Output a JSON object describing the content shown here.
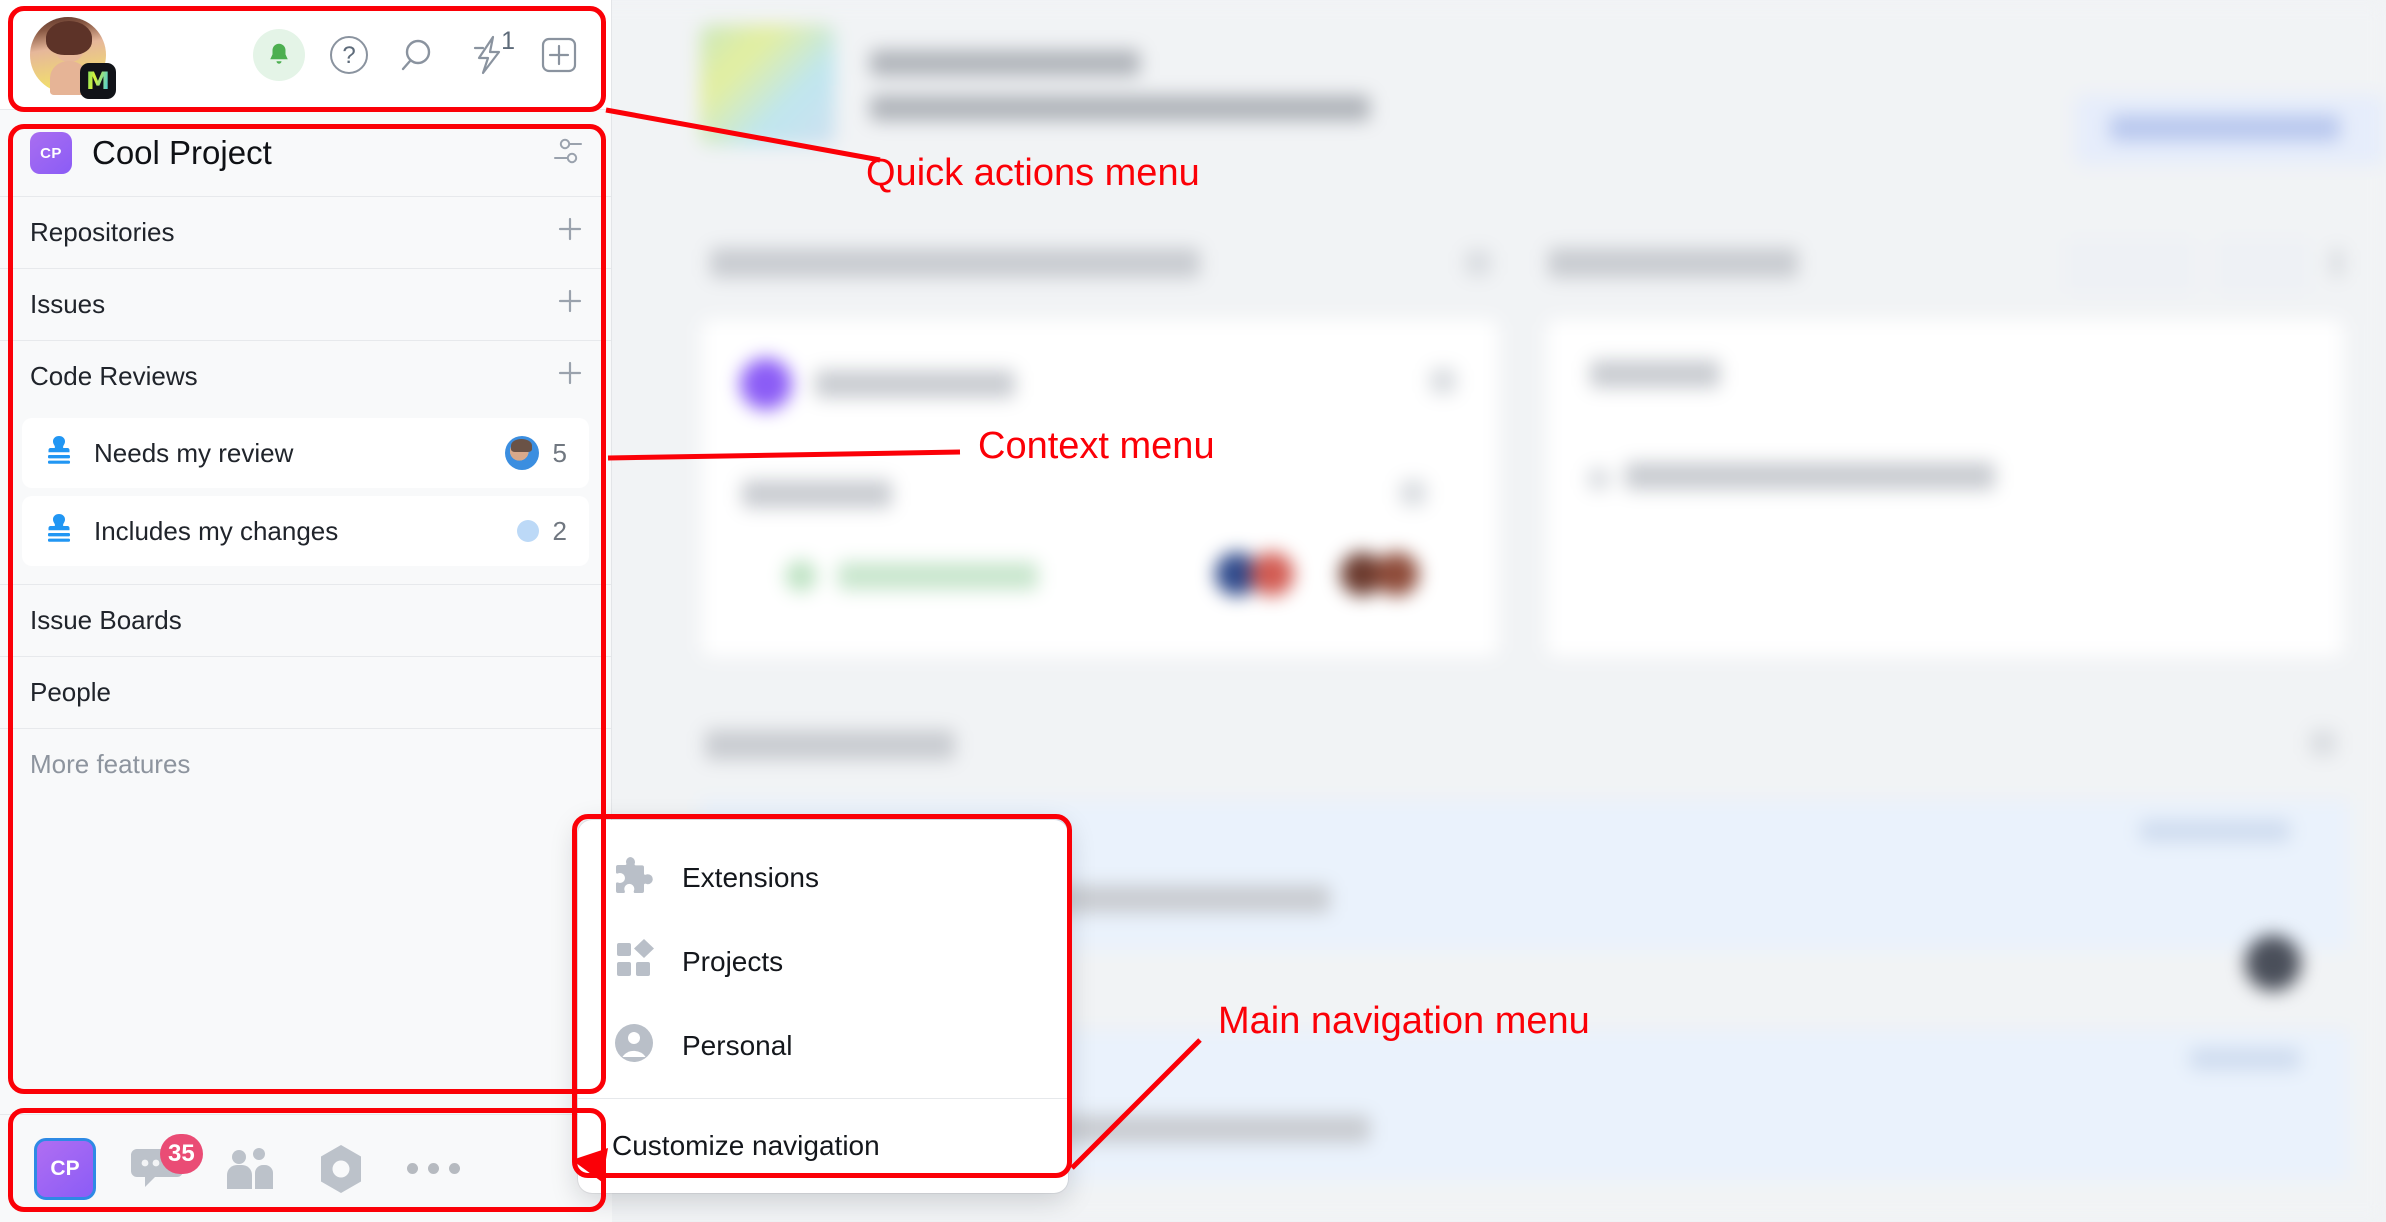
{
  "topbar": {
    "avatar_badge_letter": "M",
    "icons": [
      {
        "name": "notifications-bell-icon",
        "glyph": "bell"
      },
      {
        "name": "help-icon",
        "glyph": "question"
      },
      {
        "name": "search-icon",
        "glyph": "magnifier"
      },
      {
        "name": "quick-actions-lightning-icon",
        "glyph": "lightning",
        "superscript": "1"
      },
      {
        "name": "add-new-icon",
        "glyph": "plus-square"
      }
    ],
    "lightning_superscript": "1"
  },
  "sidebar": {
    "project": {
      "logo_initials": "CP",
      "title": "Cool Project",
      "settings_icon": "sliders-icon",
      "logo_color": "#8b5cf6"
    },
    "nav": [
      {
        "label": "Repositories",
        "action": "+"
      },
      {
        "label": "Issues",
        "action": "+"
      },
      {
        "label": "Code Reviews",
        "action": "+"
      }
    ],
    "code_reviews": [
      {
        "label": "Needs my review",
        "icon": "stamp-icon",
        "count": "5",
        "indicator": "avatar"
      },
      {
        "label": "Includes my changes",
        "icon": "stamp-icon",
        "count": "2",
        "indicator": "dot"
      }
    ],
    "nav_lower": [
      {
        "label": "Issue Boards"
      },
      {
        "label": "People"
      }
    ],
    "more_features_label": "More features"
  },
  "dock": {
    "project_initials": "CP",
    "chat_badge": "35",
    "items": [
      {
        "name": "dock-project-cp",
        "label": "CP"
      },
      {
        "name": "dock-chat-icon",
        "badge": "35"
      },
      {
        "name": "dock-meetings-icon"
      },
      {
        "name": "dock-hub-icon"
      },
      {
        "name": "dock-more-icon"
      }
    ]
  },
  "popup": {
    "items": [
      {
        "label": "Extensions",
        "icon": "puzzle-icon"
      },
      {
        "label": "Projects",
        "icon": "grid-diamond-icon"
      },
      {
        "label": "Personal",
        "icon": "person-circle-icon"
      }
    ],
    "footer_label": "Customize navigation"
  },
  "annotations": {
    "accent_color": "#fb0007",
    "labels": [
      {
        "key": "quick_actions",
        "text": "Quick actions menu"
      },
      {
        "key": "context",
        "text": "Context menu"
      },
      {
        "key": "main_nav",
        "text": "Main navigation menu"
      }
    ],
    "quick_actions": "Quick actions menu",
    "context": "Context menu",
    "main_nav": "Main navigation menu"
  }
}
